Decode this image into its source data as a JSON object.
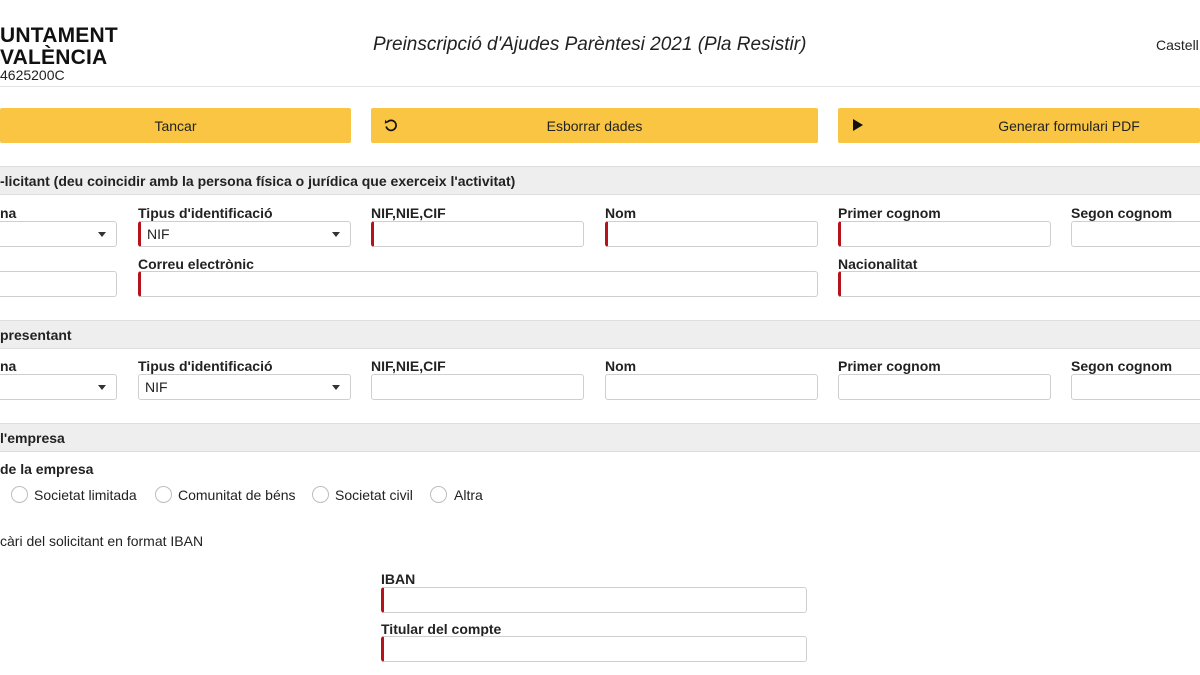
{
  "header": {
    "logo_line1": "UNTAMENT",
    "logo_line2": "VALÈNCIA",
    "logo_id": "4625200C",
    "title": "Preinscripció d'Ajudes Parèntesi 2021 (Pla Resistir)",
    "language": "Castell"
  },
  "toolbar": {
    "close_label": "Tancar",
    "clear_label": "Esborrar dades",
    "generate_label": "Generar formulari PDF"
  },
  "applicant": {
    "section_title": "-licitant (deu coincidir amb la persona física o jurídica que exerceix l'activitat)",
    "person_type_label": "na",
    "id_type_label": "Tipus d'identificació",
    "id_type_value": "NIF",
    "nif_label": "NIF,NIE,CIF",
    "name_label": "Nom",
    "surname1_label": "Primer cognom",
    "surname2_label": "Segon cognom",
    "email_label": "Correu electrònic",
    "nationality_label": "Nacionalitat"
  },
  "representative": {
    "section_title": "presentant",
    "person_type_label": "na",
    "id_type_label": "Tipus d'identificació",
    "id_type_value": "NIF",
    "nif_label": "NIF,NIE,CIF",
    "name_label": "Nom",
    "surname1_label": "Primer cognom",
    "surname2_label": "Segon cognom"
  },
  "company": {
    "section_title": "l'empresa",
    "type_label": "de la empresa",
    "options": [
      "Societat limitada",
      "Comunitat de béns",
      "Societat civil",
      "Altra"
    ]
  },
  "bank": {
    "intro": "càri del solicitant en format IBAN",
    "iban_label": "IBAN",
    "holder_label": "Titular del compte"
  },
  "colors": {
    "accent": "#f9c543",
    "required": "#b5121b",
    "section_bg": "#eeeeee"
  }
}
